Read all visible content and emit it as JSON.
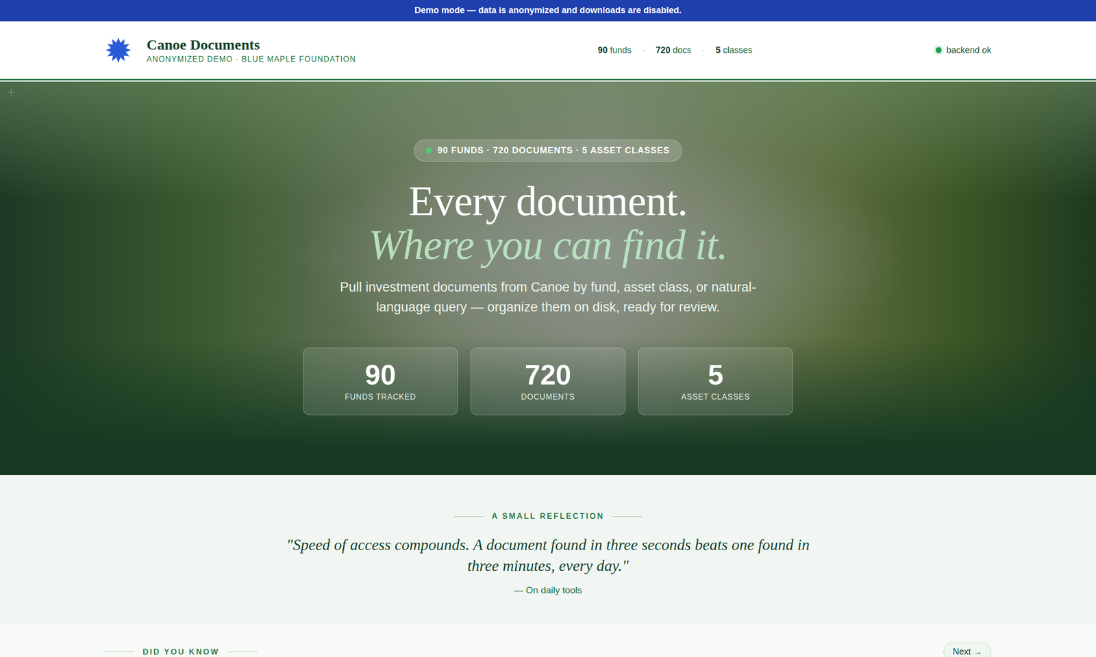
{
  "banner": {
    "text": "Demo mode — data is anonymized and downloads are disabled."
  },
  "header": {
    "title": "Canoe Documents",
    "subtitle": "ANONYMIZED DEMO · BLUE MAPLE FOUNDATION",
    "stats": [
      {
        "value": "90",
        "label": "funds"
      },
      {
        "value": "720",
        "label": "docs"
      },
      {
        "value": "5",
        "label": "classes"
      }
    ],
    "separator": "·",
    "status": {
      "label": "backend ok",
      "ok": true,
      "color": "#1f9d4a"
    }
  },
  "hero": {
    "badge": "90 FUNDS · 720 DOCUMENTS · 5 ASSET CLASSES",
    "title": "Every document.",
    "title_italic": "Where you can find it.",
    "description": "Pull investment documents from Canoe by fund, asset class, or natural-language query — organize them on disk, ready for review.",
    "stats": [
      {
        "value": "90",
        "label": "FUNDS TRACKED"
      },
      {
        "value": "720",
        "label": "DOCUMENTS"
      },
      {
        "value": "5",
        "label": "ASSET CLASSES"
      }
    ]
  },
  "reflection": {
    "label": "A SMALL REFLECTION",
    "quote": "\"Speed of access compounds. A document found in three seconds beats one found in three minutes, every day.\"",
    "attribution": "— On daily tools"
  },
  "did_you_know": {
    "label": "DID YOU KNOW",
    "button": "Next →"
  }
}
